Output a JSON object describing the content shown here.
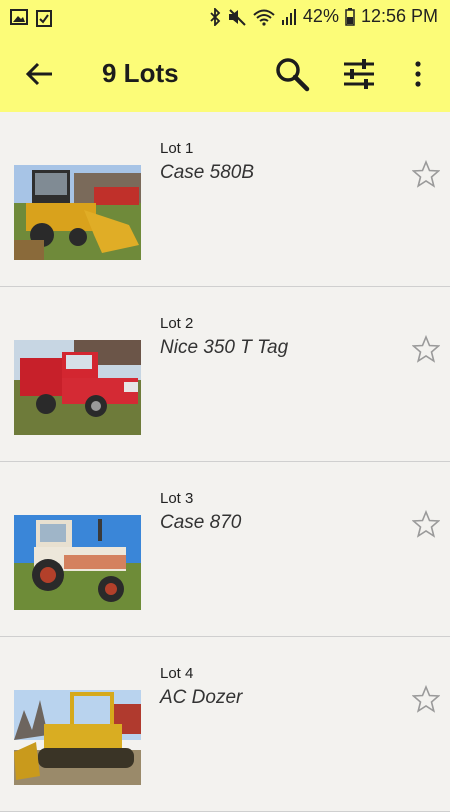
{
  "status_bar": {
    "battery": "42%",
    "time": "12:56 PM"
  },
  "toolbar": {
    "title": "9 Lots"
  },
  "lots": [
    {
      "number": "Lot 1",
      "name": "Case 580B",
      "image": "backhoe-loader-photo"
    },
    {
      "number": "Lot 2",
      "name": "Nice 350 T Tag",
      "image": "red-dump-truck-photo"
    },
    {
      "number": "Lot 3",
      "name": "Case 870",
      "image": "white-tractor-photo"
    },
    {
      "number": "Lot 4",
      "name": "AC Dozer",
      "image": "yellow-dozer-photo"
    }
  ],
  "colors": {
    "header": "#fcfc78",
    "background": "#f3f2ef"
  }
}
